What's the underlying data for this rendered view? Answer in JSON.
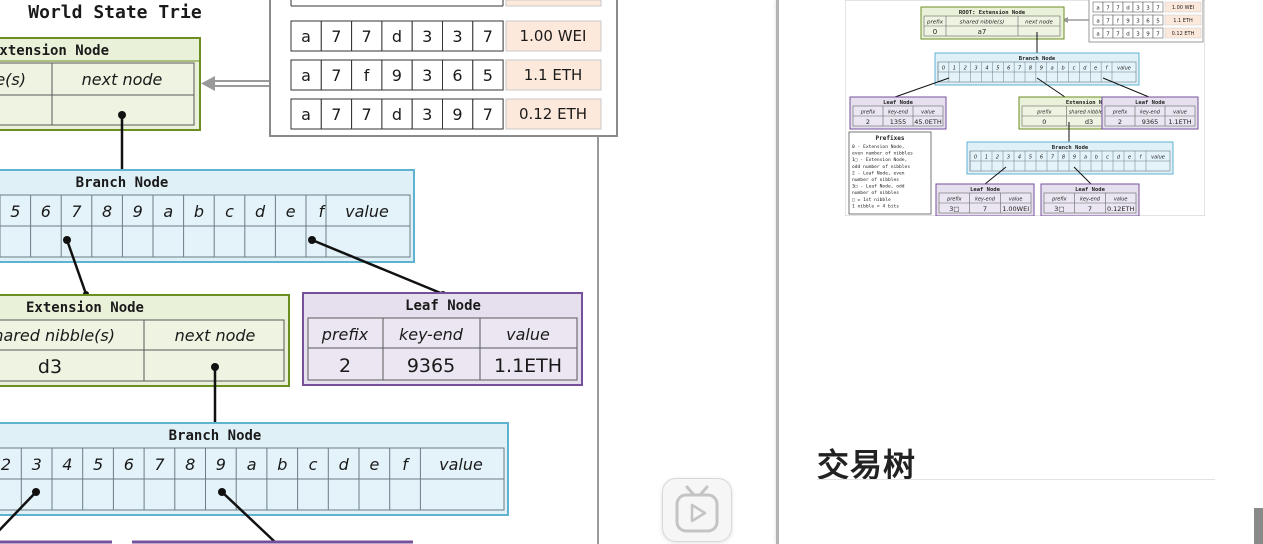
{
  "diagram": {
    "title": "World State Trie",
    "top_extension": {
      "title": "Extension Node",
      "col1": "nibble(s)",
      "col2": "next node"
    },
    "accounts": [
      {
        "chars": [
          "a",
          "7",
          "7",
          "d",
          "3",
          "3",
          "7"
        ],
        "value": "1.00 WEI"
      },
      {
        "chars": [
          "a",
          "7",
          "f",
          "9",
          "3",
          "6",
          "5"
        ],
        "value": "1.1 ETH"
      },
      {
        "chars": [
          "a",
          "7",
          "7",
          "d",
          "3",
          "9",
          "7"
        ],
        "value": "0.12 ETH"
      }
    ],
    "branch1": {
      "title": "Branch Node",
      "cells": [
        "5",
        "6",
        "7",
        "8",
        "9",
        "a",
        "b",
        "c",
        "d",
        "e",
        "f"
      ],
      "value_label": "value"
    },
    "extension2": {
      "title": "Extension Node",
      "col1": "shared nibble(s)",
      "col2": "next node",
      "val1": "d3"
    },
    "leaf1": {
      "title": "Leaf Node",
      "headers": [
        "prefix",
        "key-end",
        "value"
      ],
      "values": [
        "2",
        "9365",
        "1.1ETH"
      ]
    },
    "branch2": {
      "title": "Branch Node",
      "cells": [
        "2",
        "3",
        "4",
        "5",
        "6",
        "7",
        "8",
        "9",
        "a",
        "b",
        "c",
        "d",
        "e",
        "f"
      ],
      "value_label": "value"
    }
  },
  "thumbnail": {
    "root_title": "ROOT: Extension Node",
    "root_headers": [
      "prefix",
      "shared nibble(s)",
      "next node"
    ],
    "root_values": [
      "0",
      "a7"
    ],
    "accounts": [
      {
        "chars": [
          "a",
          "7",
          "7",
          "d",
          "3",
          "3",
          "7"
        ],
        "value": "1.00 WEI"
      },
      {
        "chars": [
          "a",
          "7",
          "f",
          "9",
          "3",
          "6",
          "5"
        ],
        "value": "1.1 ETH"
      },
      {
        "chars": [
          "a",
          "7",
          "7",
          "d",
          "3",
          "9",
          "7"
        ],
        "value": "0.12 ETH"
      }
    ],
    "branch_title": "Branch Node",
    "branch_cells": [
      "0",
      "1",
      "2",
      "3",
      "4",
      "5",
      "6",
      "7",
      "8",
      "9",
      "a",
      "b",
      "c",
      "d",
      "e",
      "f",
      "value"
    ],
    "leaf_a": {
      "title": "Leaf Node",
      "headers": [
        "prefix",
        "key-end",
        "value"
      ],
      "values": [
        "2",
        "1355",
        "45.0ETH"
      ]
    },
    "ext": {
      "title": "Extension Node",
      "headers": [
        "prefix",
        "shared nibble(s)",
        "next node"
      ],
      "values": [
        "0",
        "d3"
      ]
    },
    "leaf_b": {
      "title": "Leaf Node",
      "headers": [
        "prefix",
        "key-end",
        "value"
      ],
      "values": [
        "2",
        "9365",
        "1.1ETH"
      ]
    },
    "prefixes_title": "Prefixes",
    "prefixes": [
      "0 - Extension Node,",
      "even number of nibbles",
      "1□ - Extension Node,",
      "odd number of nibbles",
      "2 - Leaf Node, even",
      "number of nibbles",
      "3□ - Leaf Node, odd",
      "number of nibbles",
      "□ = 1st nibble",
      "1 nibble = 4 bits"
    ],
    "leaf_c": {
      "title": "Leaf Node",
      "headers": [
        "prefix",
        "key-end",
        "value"
      ],
      "values": [
        "3□",
        "7",
        "1.00WEI"
      ]
    },
    "leaf_d": {
      "title": "Leaf Node",
      "headers": [
        "prefix",
        "key-end",
        "value"
      ],
      "values": [
        "3□",
        "7",
        "0.12ETH"
      ]
    }
  },
  "section": {
    "title": "交易树"
  },
  "colors": {
    "ext_fill": "#eaf1d9",
    "ext_border": "#6b8e23",
    "branch_fill": "#dff0f7",
    "branch_border": "#5fb2d0",
    "leaf_fill": "#e6e0ee",
    "leaf_border": "#76509a",
    "value_fill": "#fde9dc"
  }
}
